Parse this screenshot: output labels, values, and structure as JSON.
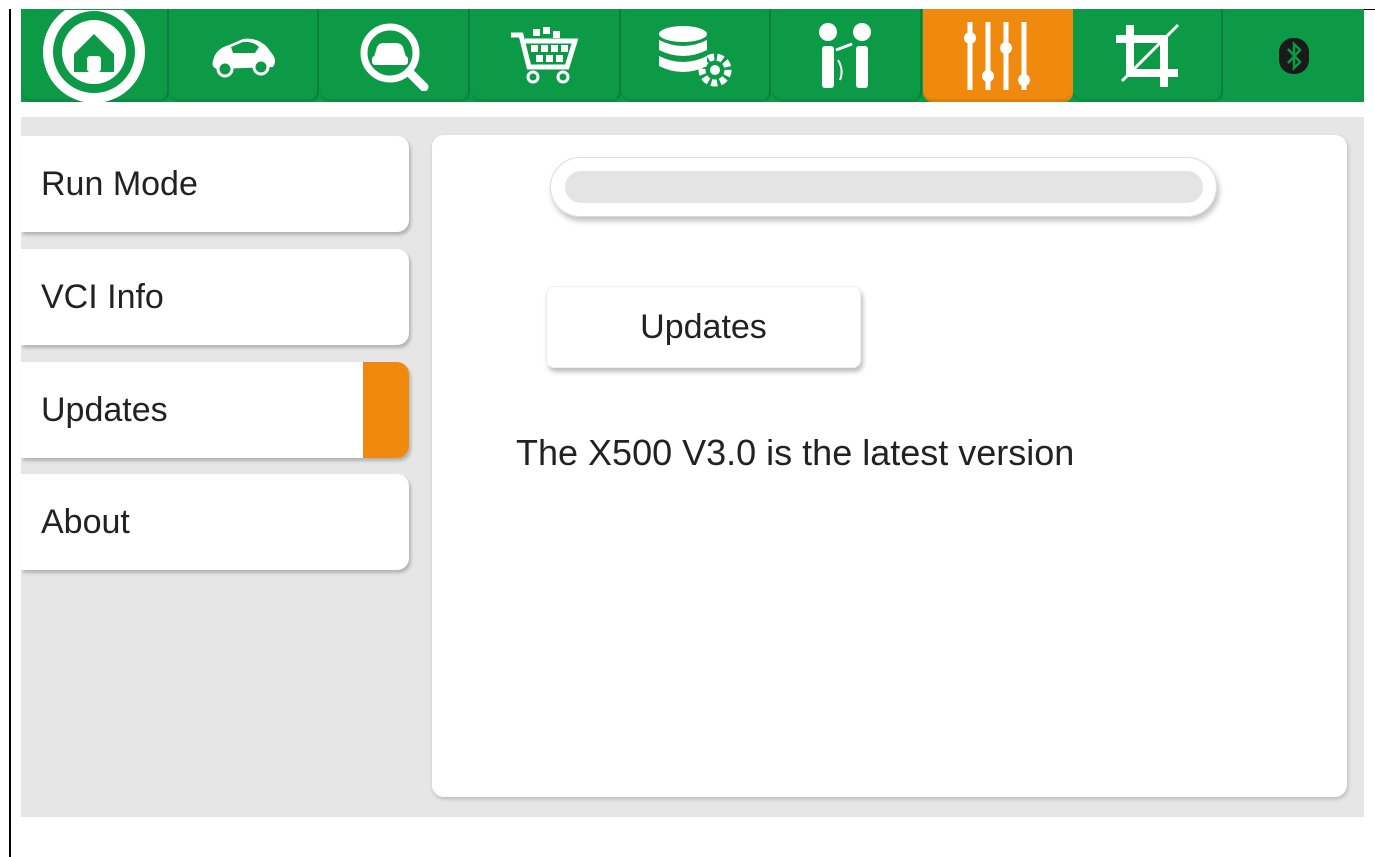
{
  "toolbar": {
    "tabs": [
      {
        "name": "home",
        "icon": "home-icon"
      },
      {
        "name": "vehicle",
        "icon": "car-icon"
      },
      {
        "name": "diagnose-search",
        "icon": "car-search-icon"
      },
      {
        "name": "shop",
        "icon": "cart-icon"
      },
      {
        "name": "data-settings",
        "icon": "database-gear-icon"
      },
      {
        "name": "people",
        "icon": "people-icon"
      },
      {
        "name": "settings",
        "icon": "sliders-icon",
        "active": true
      },
      {
        "name": "crop",
        "icon": "crop-icon"
      }
    ],
    "status_icon": "bluetooth-icon",
    "colors": {
      "bar": "#0d9a46",
      "active": "#f08a0e"
    }
  },
  "sidebar": {
    "items": [
      {
        "label": "Run Mode"
      },
      {
        "label": "VCI Info"
      },
      {
        "label": "Updates",
        "selected": true
      },
      {
        "label": "About"
      }
    ]
  },
  "main": {
    "progress_percent": 0,
    "update_button_label": "Updates",
    "status_message": "The X500 V3.0 is the latest version"
  }
}
